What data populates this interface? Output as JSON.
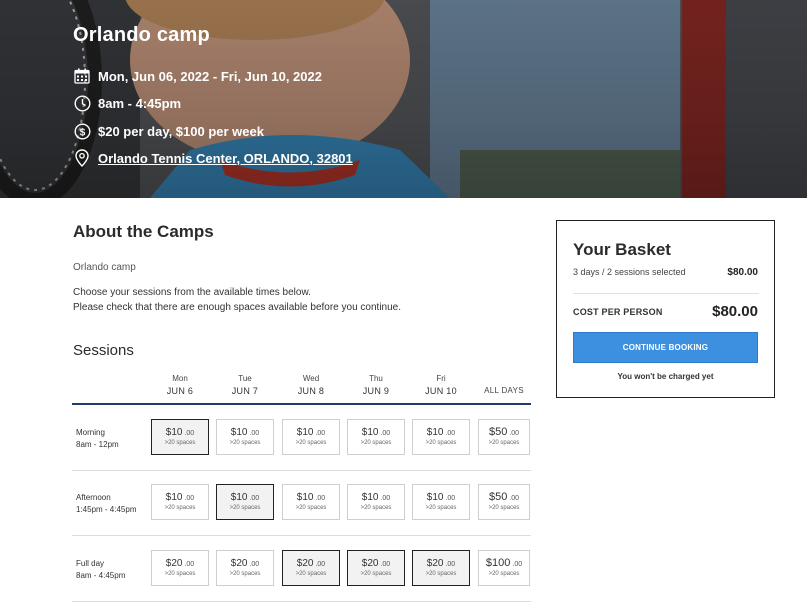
{
  "hero": {
    "title": "Orlando camp",
    "dates": "Mon, Jun 06, 2022 - Fri, Jun 10, 2022",
    "time": "8am - 4:45pm",
    "price": "$20 per day, $100 per week",
    "location": "Orlando Tennis Center, ORLANDO, 32801",
    "icons": [
      "calendar-icon",
      "clock-icon",
      "dollar-icon",
      "location-pin-icon"
    ]
  },
  "about": {
    "title": "About the Camps",
    "camp_name": "Orlando camp",
    "instruction_1": "Choose your sessions from the available times below.",
    "instruction_2": "Please check that there are enough spaces available before you continue."
  },
  "sessions": {
    "title": "Sessions",
    "days": [
      {
        "name": "Mon",
        "date": "JUN 6"
      },
      {
        "name": "Tue",
        "date": "JUN 7"
      },
      {
        "name": "Wed",
        "date": "JUN 8"
      },
      {
        "name": "Thu",
        "date": "JUN 9"
      },
      {
        "name": "Fri",
        "date": "JUN 10"
      }
    ],
    "all_days_label": "ALL DAYS",
    "rows": [
      {
        "name": "Morning",
        "time": "8am - 12pm",
        "slots": [
          {
            "price": "$10",
            "cents": ".00",
            "spaces": ">20 spaces",
            "selected": true
          },
          {
            "price": "$10",
            "cents": ".00",
            "spaces": ">20 spaces",
            "selected": false
          },
          {
            "price": "$10",
            "cents": ".00",
            "spaces": ">20 spaces",
            "selected": false
          },
          {
            "price": "$10",
            "cents": ".00",
            "spaces": ">20 spaces",
            "selected": false
          },
          {
            "price": "$10",
            "cents": ".00",
            "spaces": ">20 spaces",
            "selected": false
          }
        ],
        "all": {
          "price": "$50",
          "cents": ".00",
          "spaces": ">20 spaces"
        }
      },
      {
        "name": "Afternoon",
        "time": "1:45pm - 4:45pm",
        "slots": [
          {
            "price": "$10",
            "cents": ".00",
            "spaces": ">20 spaces",
            "selected": false
          },
          {
            "price": "$10",
            "cents": ".00",
            "spaces": ">20 spaces",
            "selected": true
          },
          {
            "price": "$10",
            "cents": ".00",
            "spaces": ">20 spaces",
            "selected": false
          },
          {
            "price": "$10",
            "cents": ".00",
            "spaces": ">20 spaces",
            "selected": false
          },
          {
            "price": "$10",
            "cents": ".00",
            "spaces": ">20 spaces",
            "selected": false
          }
        ],
        "all": {
          "price": "$50",
          "cents": ".00",
          "spaces": ">20 spaces"
        }
      },
      {
        "name": "Full day",
        "time": "8am - 4:45pm",
        "slots": [
          {
            "price": "$20",
            "cents": ".00",
            "spaces": ">20 spaces",
            "selected": false
          },
          {
            "price": "$20",
            "cents": ".00",
            "spaces": ">20 spaces",
            "selected": false
          },
          {
            "price": "$20",
            "cents": ".00",
            "spaces": ">20 spaces",
            "selected": true
          },
          {
            "price": "$20",
            "cents": ".00",
            "spaces": ">20 spaces",
            "selected": true
          },
          {
            "price": "$20",
            "cents": ".00",
            "spaces": ">20 spaces",
            "selected": true
          }
        ],
        "all": {
          "price": "$100",
          "cents": ".00",
          "spaces": ">20 spaces"
        }
      }
    ]
  },
  "basket": {
    "title": "Your Basket",
    "summary": "3 days / 2 sessions selected",
    "summary_price": "$80.00",
    "cost_label": "COST PER PERSON",
    "cost": "$80.00",
    "button_label": "CONTINUE BOOKING",
    "note": "You won't be charged yet"
  },
  "colors": {
    "accent_button": "#3d8fe0",
    "table_header_line": "#1f3d6b",
    "selected_border": "#222222"
  }
}
